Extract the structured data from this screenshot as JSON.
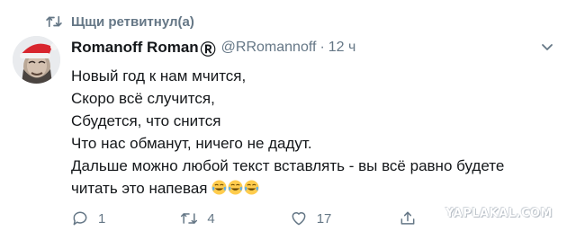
{
  "retweet": {
    "label": "Щщи ретвитнул(а)",
    "icon": "retweet-icon"
  },
  "author": {
    "display_name": "Romanoff Roman",
    "badge": "Ⓡ",
    "handle": "@RRomannoff",
    "separator": "·",
    "time": "12 ч"
  },
  "tweet": {
    "lines": [
      "Новый год к нам мчится,",
      "Скоро всё случится,",
      "Сбудется, что снится",
      "Что нас обманут, ничего не дадут.",
      "Дальше можно любой текст вставлять - вы всё равно будете",
      "читать это напевая"
    ],
    "emoji_name": "face-with-tears-of-joy",
    "emoji_count": 3
  },
  "actions": {
    "reply": {
      "icon": "reply-icon",
      "count": "1"
    },
    "retweet": {
      "icon": "retweet-icon",
      "count": "4"
    },
    "like": {
      "icon": "heart-icon",
      "count": "17"
    },
    "share": {
      "icon": "share-icon"
    }
  },
  "watermark": {
    "text": "YAPLAKAL.COM"
  },
  "colors": {
    "text": "#14171a",
    "muted": "#657786",
    "emoji": "#ffcc4d",
    "santa_hat": "#d8262e"
  }
}
